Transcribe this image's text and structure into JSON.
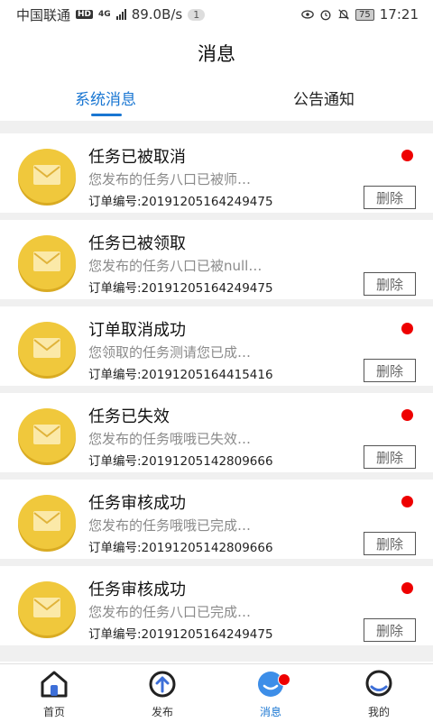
{
  "status_bar": {
    "carrier": "中国联通",
    "hd": "HD",
    "net": "4G",
    "speed": "89.0B/s",
    "notif_count": "1",
    "battery": "75",
    "time": "17:21"
  },
  "header": {
    "title": "消息"
  },
  "tabs": [
    {
      "label": "系统消息",
      "active": true
    },
    {
      "label": "公告通知",
      "active": false
    }
  ],
  "messages": [
    {
      "title": "任务已被取消",
      "summary": "您发布的任务八口已被师…",
      "order": "订单编号:20191205164249475",
      "unread": true,
      "delete_label": "删除"
    },
    {
      "title": "任务已被领取",
      "summary": "您发布的任务八口已被null…",
      "order": "订单编号:20191205164249475",
      "unread": false,
      "delete_label": "删除"
    },
    {
      "title": "订单取消成功",
      "summary": "您领取的任务测请您已成…",
      "order": "订单编号:20191205164415416",
      "unread": true,
      "delete_label": "删除"
    },
    {
      "title": "任务已失效",
      "summary": "您发布的任务哦哦已失效…",
      "order": "订单编号:20191205142809666",
      "unread": true,
      "delete_label": "删除"
    },
    {
      "title": "任务审核成功",
      "summary": "您发布的任务哦哦已完成…",
      "order": "订单编号:20191205142809666",
      "unread": true,
      "delete_label": "删除"
    },
    {
      "title": "任务审核成功",
      "summary": "您发布的任务八口已完成…",
      "order": "订单编号:20191205164249475",
      "unread": true,
      "delete_label": "删除"
    }
  ],
  "bottom_nav": [
    {
      "label": "首页",
      "icon": "home-icon",
      "active": false
    },
    {
      "label": "发布",
      "icon": "publish-icon",
      "active": false
    },
    {
      "label": "消息",
      "icon": "message-icon",
      "active": true,
      "badge": true
    },
    {
      "label": "我的",
      "icon": "profile-icon",
      "active": false
    }
  ],
  "colors": {
    "accent": "#1976d2",
    "unread_dot": "#ee0000",
    "envelope": "#f0c83c"
  }
}
